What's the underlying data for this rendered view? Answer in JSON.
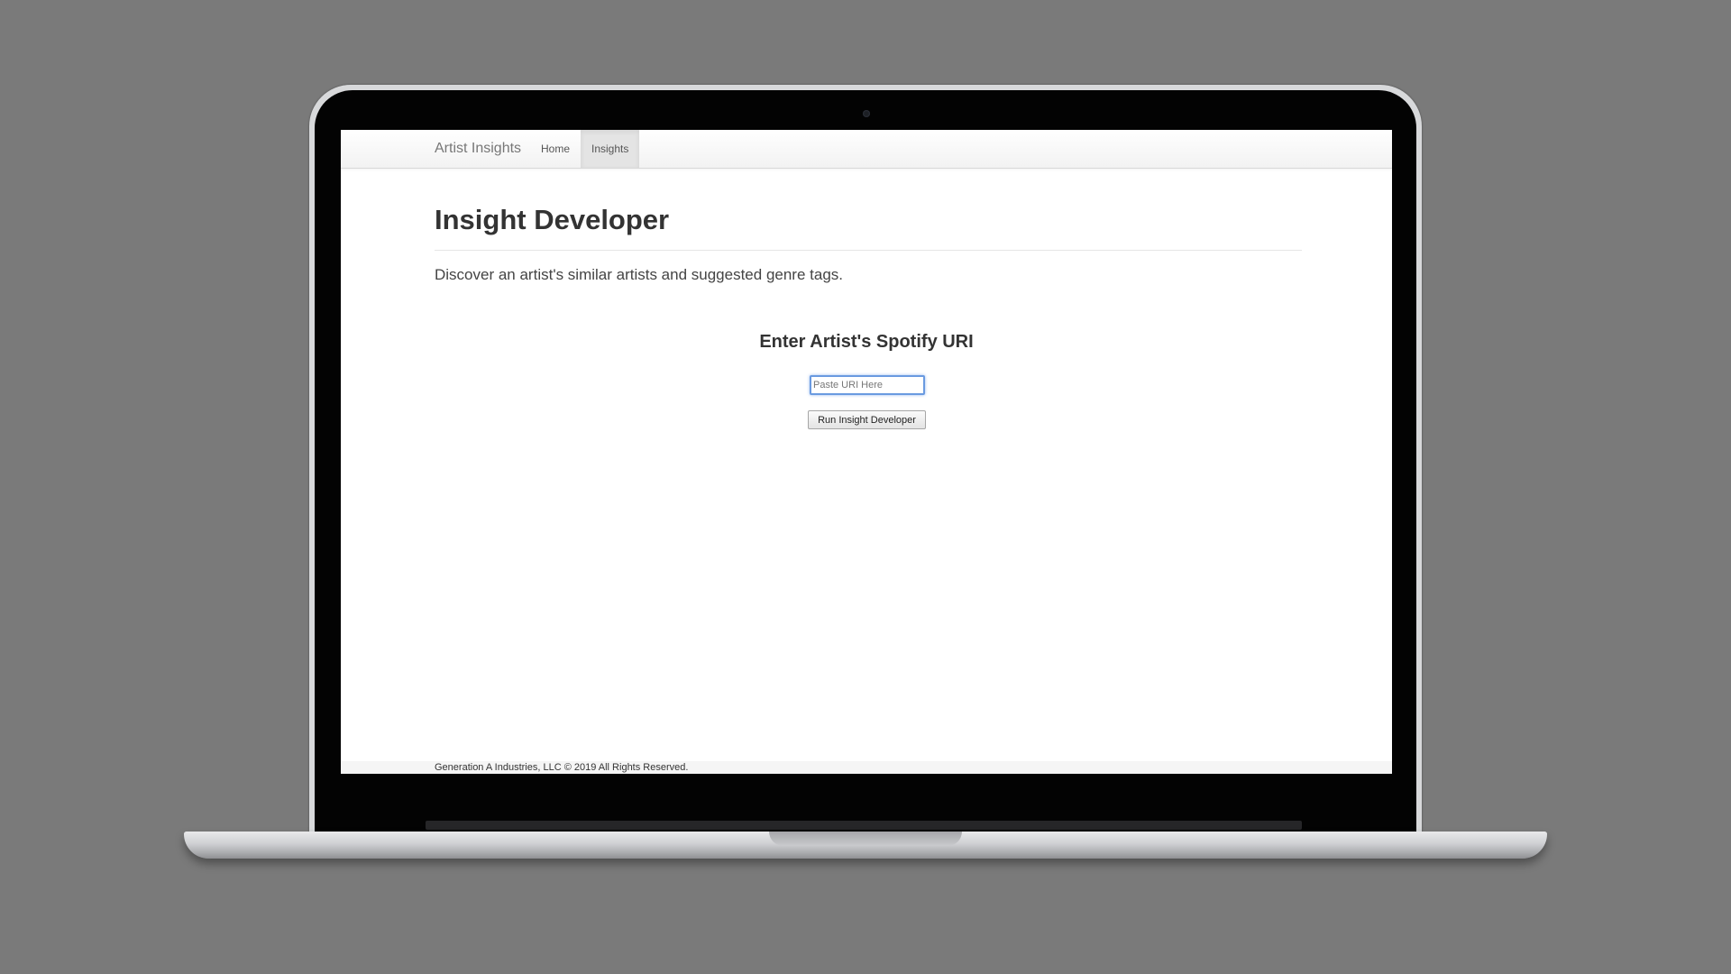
{
  "navbar": {
    "brand": "Artist Insights",
    "links": [
      {
        "label": "Home",
        "active": false
      },
      {
        "label": "Insights",
        "active": true
      }
    ]
  },
  "main": {
    "title": "Insight Developer",
    "description": "Discover an artist's similar artists and suggested genre tags.",
    "form": {
      "heading": "Enter Artist's Spotify URI",
      "uri_input": {
        "value": "",
        "placeholder": "Paste URI Here"
      },
      "submit_label": "Run Insight Developer"
    }
  },
  "footer": {
    "text": "Generation A Industries, LLC © 2019 All Rights Reserved."
  },
  "colors": {
    "backdrop": "#7a7a7a",
    "input_focus": "#6a9ae0",
    "active_tab": "#e4e4e4"
  }
}
